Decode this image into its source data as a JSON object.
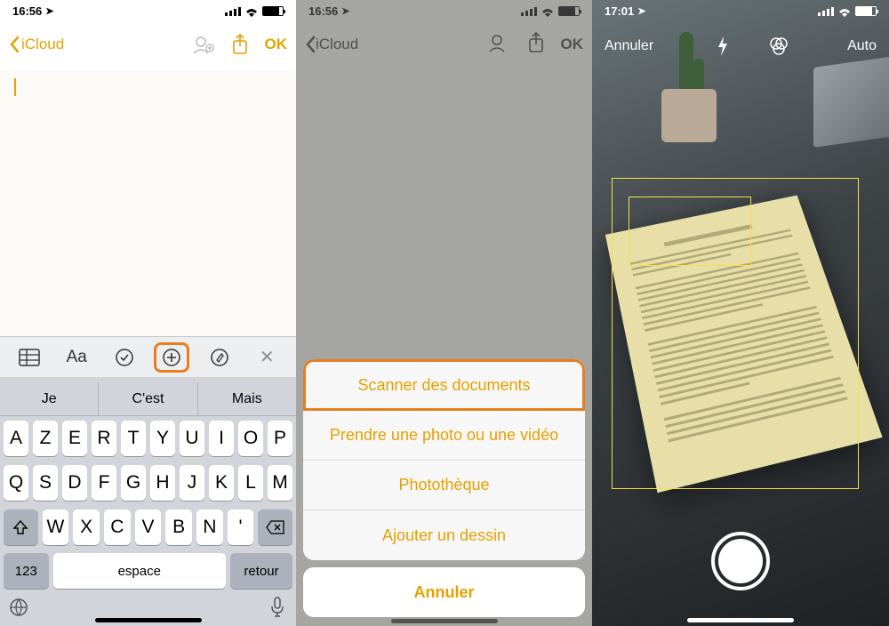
{
  "screen1": {
    "status": {
      "time": "16:56"
    },
    "nav": {
      "back": "iCloud",
      "ok": "OK"
    },
    "toolbar": {
      "items": [
        "table",
        "text-style",
        "checklist",
        "add",
        "handwriting",
        "close"
      ]
    },
    "keyboard": {
      "suggestions": [
        "Je",
        "C'est",
        "Mais"
      ],
      "row1": [
        "A",
        "Z",
        "E",
        "R",
        "T",
        "Y",
        "U",
        "I",
        "O",
        "P"
      ],
      "row2": [
        "Q",
        "S",
        "D",
        "F",
        "G",
        "H",
        "J",
        "K",
        "L",
        "M"
      ],
      "row3": [
        "W",
        "X",
        "C",
        "V",
        "B",
        "N",
        "'"
      ],
      "num_key": "123",
      "space_key": "espace",
      "return_key": "retour"
    }
  },
  "screen2": {
    "status": {
      "time": "16:56"
    },
    "nav": {
      "back": "iCloud",
      "ok": "OK"
    },
    "sheet": {
      "scan": "Scanner des documents",
      "photo": "Prendre une photo ou une vidéo",
      "library": "Photothèque",
      "drawing": "Ajouter un dessin",
      "cancel": "Annuler"
    }
  },
  "screen3": {
    "status": {
      "time": "17:01"
    },
    "topbar": {
      "cancel": "Annuler",
      "auto": "Auto"
    }
  }
}
